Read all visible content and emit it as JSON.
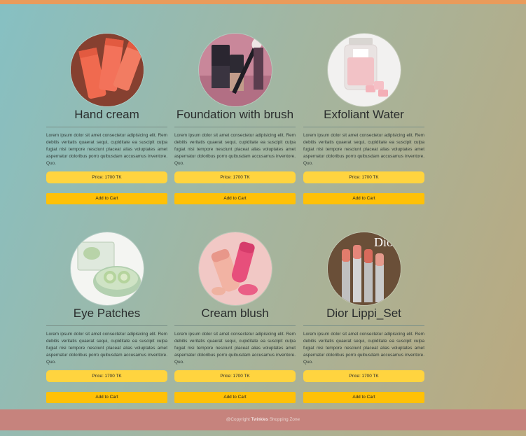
{
  "products": [
    {
      "name": "Hand cream",
      "image": "hand-cream-image",
      "desc": "Lorem ipsum dolor sit amet consectetur adipisicing elit. Rem debitis veritatis quaerat sequi, cupiditate ea suscipit culpa fugiat nisi tempore nesciunt placeat alias voluptates amet aspernatur doloribus porro quibusdam accusamus inventore. Quo.",
      "price": "Price: 1700 TK",
      "cart": "Add to Cart"
    },
    {
      "name": "Foundation with brush",
      "image": "foundation-brush-image",
      "desc": "Lorem ipsum dolor sit amet consectetur adipisicing elit. Rem debitis veritatis quaerat sequi, cupiditate ea suscipit culpa fugiat nisi tempore nesciunt placeat alias voluptates amet aspernatur doloribus porro quibusdam accusamus inventore. Quo.",
      "price": "Price: 1700 TK",
      "cart": "Add to Cart"
    },
    {
      "name": "Exfoliant Water",
      "image": "exfoliant-jar-image",
      "desc": "Lorem ipsum dolor sit amet consectetur adipisicing elit. Rem debitis veritatis quaerat sequi, cupiditate ea suscipit culpa fugiat nisi tempore nesciunt placeat alias voluptates amet aspernatur doloribus porro quibusdam accusamus inventore. Quo.",
      "price": "Price: 1700 TK",
      "cart": "Add to Cart"
    },
    {
      "name": "Eye Patches",
      "image": "eye-patches-image",
      "desc": "Lorem ipsum dolor sit amet consectetur adipisicing elit. Rem debitis veritatis quaerat sequi, cupiditate ea suscipit culpa fugiat nisi tempore nesciunt placeat alias voluptates amet aspernatur doloribus porro quibusdam accusamus inventore. Quo.",
      "price": "Price: 1700 TK",
      "cart": "Add to Cart"
    },
    {
      "name": "Cream blush",
      "image": "cream-blush-image",
      "desc": "Lorem ipsum dolor sit amet consectetur adipisicing elit. Rem debitis veritatis quaerat sequi, cupiditate ea suscipit culpa fugiat nisi tempore nesciunt placeat alias voluptates amet aspernatur doloribus porro quibusdam accusamus inventore. Quo.",
      "price": "Price: 1700 TK",
      "cart": "Add to Cart"
    },
    {
      "name": "Dior Lippi_Set",
      "image": "lipstick-set-image",
      "image_text": "Dio",
      "desc": "Lorem ipsum dolor sit amet consectetur adipisicing elit. Rem debitis veritatis quaerat sequi, cupiditate ea suscipit culpa fugiat nisi tempore nesciunt placeat alias voluptates amet aspernatur doloribus porro quibusdam accusamus inventore. Quo.",
      "price": "Price: 1700 TK",
      "cart": "Add to Cart"
    }
  ],
  "footer": {
    "prefix": "@Copyright ",
    "brand": "Twinkles",
    "suffix": " Shopping Zone"
  },
  "colors": {
    "topbar": "#e99b5b",
    "price_button": "#ffd43f",
    "cart_button": "#ffc107",
    "footer": "#c6837d"
  }
}
